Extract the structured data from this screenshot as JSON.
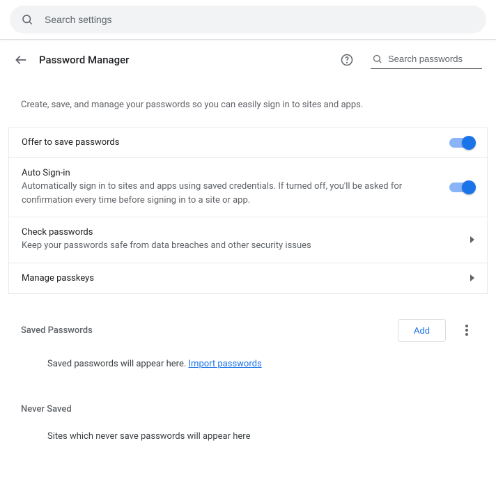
{
  "top_search": {
    "placeholder": "Search settings"
  },
  "header": {
    "title": "Password Manager",
    "search_placeholder": "Search passwords"
  },
  "intro": "Create, save, and manage your passwords so you can easily sign in to sites and apps.",
  "rows": {
    "offer_save": {
      "title": "Offer to save passwords"
    },
    "auto_signin": {
      "title": "Auto Sign-in",
      "sub": "Automatically sign in to sites and apps using saved credentials. If turned off, you'll be asked for confirmation every time before signing in to a site or app."
    },
    "check": {
      "title": "Check passwords",
      "sub": "Keep your passwords safe from data breaches and other security issues"
    },
    "passkeys": {
      "title": "Manage passkeys"
    }
  },
  "sections": {
    "saved": {
      "title": "Saved Passwords",
      "add_label": "Add",
      "empty_prefix": "Saved passwords will appear here. ",
      "import_link": "Import passwords"
    },
    "never": {
      "title": "Never Saved",
      "empty": "Sites which never save passwords will appear here"
    }
  }
}
